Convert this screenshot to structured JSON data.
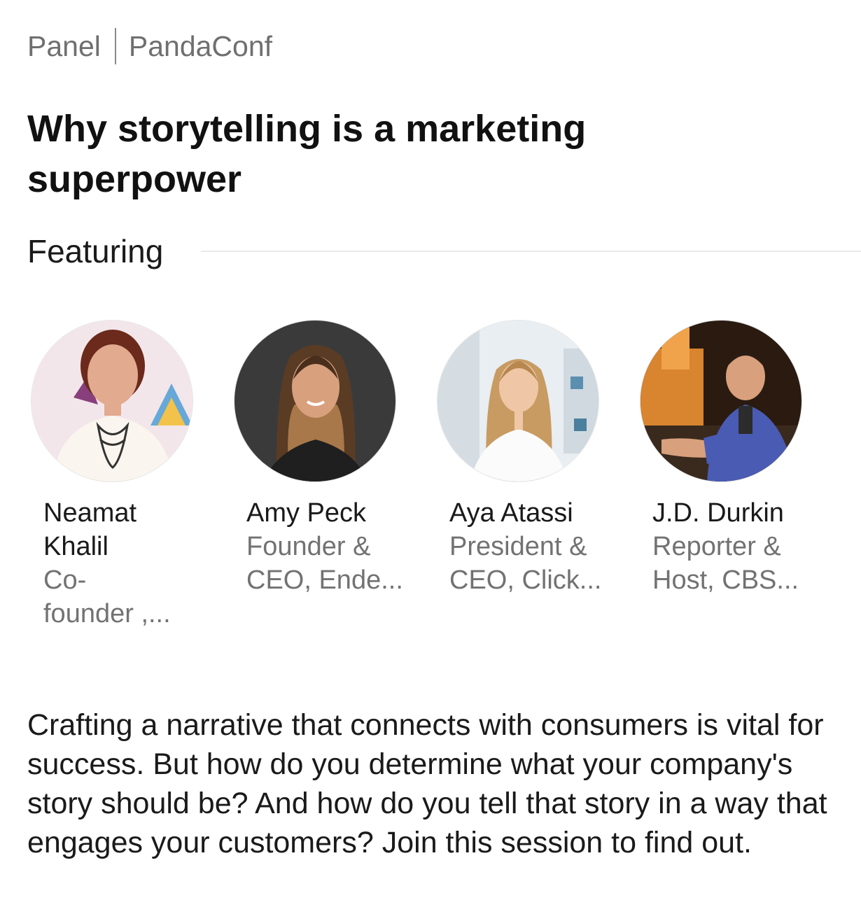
{
  "session": {
    "type_label": "Panel",
    "event_name": "PandaConf",
    "title": "Why storytelling is a marketing superpower",
    "featuring_label": "Featuring",
    "description": "Crafting a narrative that connects with consumers is vital for success. But how do you determine what your company's story should be? And how do you tell that story in a way that engages your customers? Join this session to find out."
  },
  "speakers": [
    {
      "name_line1": "Neamat",
      "name_line2": "Khalil",
      "role_line1": "Co-",
      "role_line2": "founder ,..."
    },
    {
      "name_line1": "Amy Peck",
      "name_line2": "",
      "role_line1": "Founder &",
      "role_line2": "CEO, Ende..."
    },
    {
      "name_line1": "Aya Atassi",
      "name_line2": "",
      "role_line1": "President &",
      "role_line2": "CEO, Click..."
    },
    {
      "name_line1": "J.D. Durkin",
      "name_line2": "",
      "role_line1": "Reporter &",
      "role_line2": "Host, CBS..."
    }
  ],
  "colors": {
    "meta_text": "#6f6f6f",
    "title_text": "#111111",
    "secondary_text": "#727272",
    "divider": "#e9e9e9"
  }
}
